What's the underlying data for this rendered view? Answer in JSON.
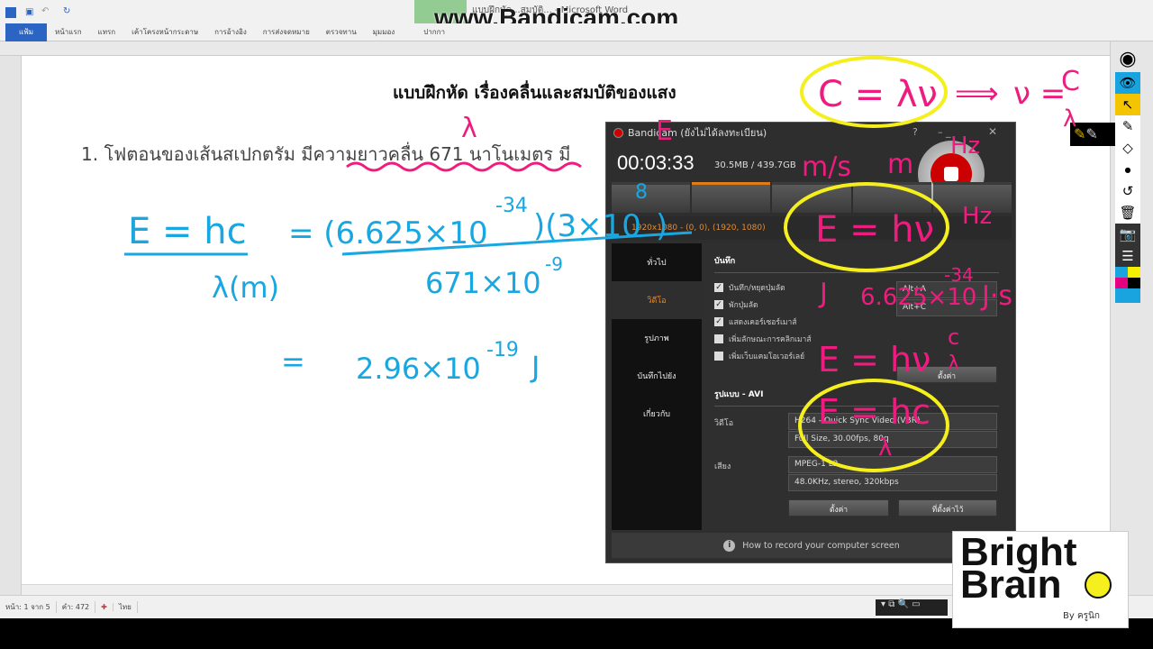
{
  "window": {
    "title": "แบบฝึกหัด...สมบัติ... - Microsoft Word",
    "watermark": "www.Bandicam.com"
  },
  "ribbon": {
    "file": "แฟ้ม",
    "tabs": [
      "หน้าแรก",
      "แทรก",
      "เค้าโครงหน้ากระดาษ",
      "การอ้างอิง",
      "การส่งจดหมาย",
      "ตรวจทาน",
      "มุมมอง",
      "ปากกา"
    ]
  },
  "document": {
    "heading": "แบบฝึกหัด  เรื่องคลื่นและสมบัติของแสง",
    "question": "1. โฟตอนของเส้นสเปกตรัม มีความยาวคลื่น 671 นาโนเมตร มี"
  },
  "status": {
    "page": "หน้า: 1 จาก 5",
    "words": "คำ: 472",
    "language": "ไทย"
  },
  "bandicam": {
    "title": "Bandicam (ยังไม่ได้ลงทะเบียน)",
    "timer": "00:03:33",
    "size": "30.5MB / 439.7GB",
    "area": "1920x1080 - (0, 0), (1920, 1080)",
    "sidebar": [
      "ทั่วไป",
      "วิดีโอ",
      "รูปภาพ",
      "บันทึกไปยัง",
      "เกี่ยวกับ"
    ],
    "record_section": "บันทึก",
    "options": [
      {
        "label": "บันทึก/หยุดปุ่มลัด",
        "checked": true,
        "hotkey": "Alt+A"
      },
      {
        "label": "พักปุ่มลัด",
        "checked": true,
        "hotkey": "Alt+C"
      },
      {
        "label": "แสดงเคอร์เซอร์เมาส์",
        "checked": true
      },
      {
        "label": "เพิ่มลักษณะการคลิกเมาส์",
        "checked": false
      },
      {
        "label": "เพิ่มเว็บแคมโอเวอร์เลย์",
        "checked": false
      }
    ],
    "settings_btn": "ตั้งค่า",
    "format_section": "รูปแบบ - AVI",
    "video_label": "วิดีโอ",
    "video_codec": "H264 - Quick Sync Video (VBR)",
    "video_detail": "Full Size, 30.00fps, 80q",
    "audio_label": "เสียง",
    "audio_codec": "MPEG-1 L2",
    "audio_detail": "48.0KHz, stereo, 320kbps",
    "btn_settings": "ตั้งค่า",
    "btn_presets": "ที่ตั้งค่าไว้",
    "footer": "How to record your computer screen"
  },
  "logo": {
    "line1": "Bright",
    "line2": "Brain",
    "by": "By  ครูนิก"
  },
  "tools": [
    "pen-icon",
    "eye-icon",
    "cursor-icon",
    "highlighter-icon",
    "eraser-icon",
    "dot-size-icon",
    "undo-icon",
    "trash-icon",
    "camera-icon",
    "page-icon",
    "color-palette"
  ],
  "annotations": {
    "blue": [
      "E = hc",
      "λ(m)",
      "= (6.625×10",
      "-34",
      ")(3×10",
      "8",
      ")",
      "671×10",
      "-9",
      "=",
      "2.96×10",
      "-19",
      "J"
    ],
    "pink": [
      "λ",
      "C = λν",
      "⟹",
      "ν =",
      "C",
      "λ",
      "E",
      "m/s",
      "m",
      "Hz",
      "Hz",
      "E = hν",
      "J",
      "6.625×10",
      "-34",
      "J·s",
      "E = hν",
      "c",
      "λ",
      "E = hc",
      "λ"
    ],
    "colors": {
      "blue": "#18a7e0",
      "pink": "#ee1c7f",
      "yellow": "#f5ef1e"
    }
  }
}
